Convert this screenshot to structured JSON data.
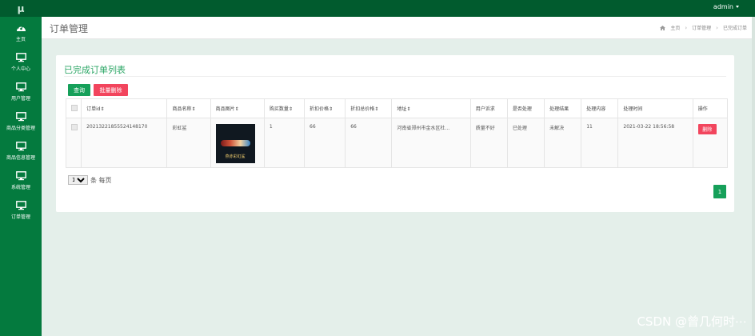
{
  "brand": {
    "logo": "μ"
  },
  "topbar": {
    "user": "admin"
  },
  "sidebar": {
    "items": [
      {
        "label": "主页",
        "icon": "dashboard-icon"
      },
      {
        "label": "个人中心",
        "icon": "monitor-icon"
      },
      {
        "label": "用户管理",
        "icon": "monitor-icon"
      },
      {
        "label": "商品分类管理",
        "icon": "monitor-icon"
      },
      {
        "label": "商品信息管理",
        "icon": "monitor-icon"
      },
      {
        "label": "系统管理",
        "icon": "monitor-icon"
      },
      {
        "label": "订单管理",
        "icon": "monitor-icon"
      }
    ]
  },
  "header": {
    "title": "订单管理",
    "breadcrumb": [
      "主页",
      "订单管理",
      "已完成订单"
    ]
  },
  "panel": {
    "title": "已完成订单列表",
    "query_label": "查询",
    "batch_delete_label": "批量删除"
  },
  "table": {
    "columns": [
      "订单id",
      "商品名称",
      "商品图片",
      "购买数量",
      "折扣价格",
      "折扣总价格",
      "地址",
      "用户诉求",
      "是否处理",
      "处理结果",
      "处理内容",
      "处理时间",
      "操作"
    ],
    "rows": [
      {
        "order_id": "20213221855524148170",
        "product_name": "彩虹鲨",
        "image_caption": "燕赤彩虹鲨",
        "quantity": "1",
        "discount_price": "66",
        "discount_total": "66",
        "address": "河南省郑州市金水区杜...",
        "user_request": "质量不好",
        "handled": "已处理",
        "result": "未解决",
        "content": "11",
        "time": "2021-03-22 18:56:58",
        "delete_label": "删除"
      }
    ]
  },
  "pagination": {
    "page_size": "10",
    "page_size_suffix": "条 每页",
    "current_page": "1"
  },
  "watermark": "CSDN @曾几何时⋯",
  "colors": {
    "topbar": "#015b2e",
    "sidebar": "#047a3e",
    "primary": "#16a05a",
    "danger": "#f2455d",
    "title": "#2aa564"
  }
}
